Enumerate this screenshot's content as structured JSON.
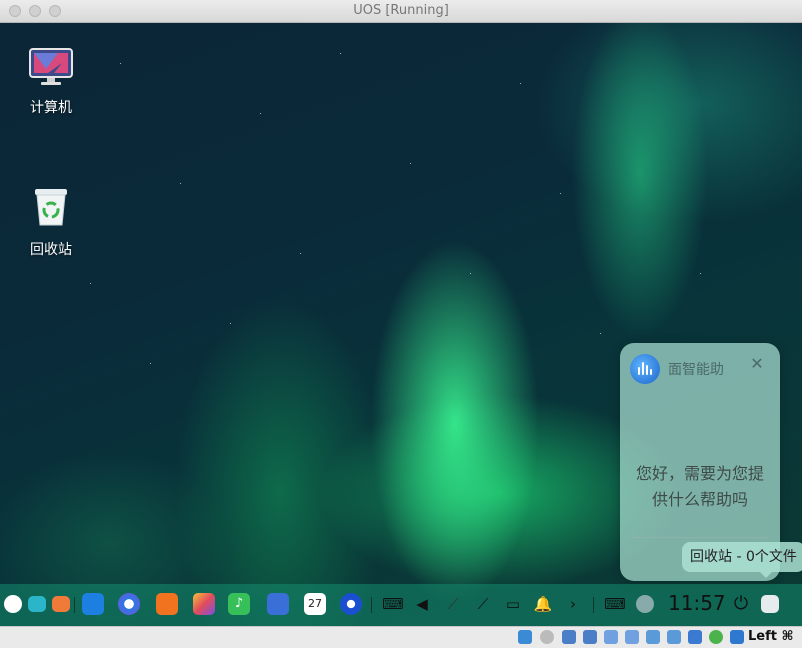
{
  "window": {
    "title": "UOS [Running]"
  },
  "desktop": {
    "icons": [
      {
        "label": "计算机",
        "icon": "computer-icon"
      },
      {
        "label": "回收站",
        "icon": "trash-icon"
      }
    ]
  },
  "assistant": {
    "title": "面智能助",
    "message": "您好，需要为您提供什么帮助吗"
  },
  "tooltip": {
    "text": "回收站 - 0个文件"
  },
  "dock": {
    "apps": [
      "launcher-icon",
      "multitask-icon",
      "app-store-icon",
      "file-manager-icon",
      "browser-icon",
      "music-player-icon",
      "image-viewer-icon",
      "music-icon",
      "document-viewer-icon",
      "calendar-icon",
      "settings-icon"
    ],
    "calendar_day": "27",
    "tray": [
      "keyboard-icon",
      "volume-icon",
      "network-off-icon",
      "network-icon",
      "battery-icon",
      "notification-bell-icon",
      "expand-arrow-icon",
      "input-method-icon",
      "assistant-icon"
    ],
    "clock": "11:57"
  },
  "statusbar": {
    "host_key": "Left ⌘"
  }
}
